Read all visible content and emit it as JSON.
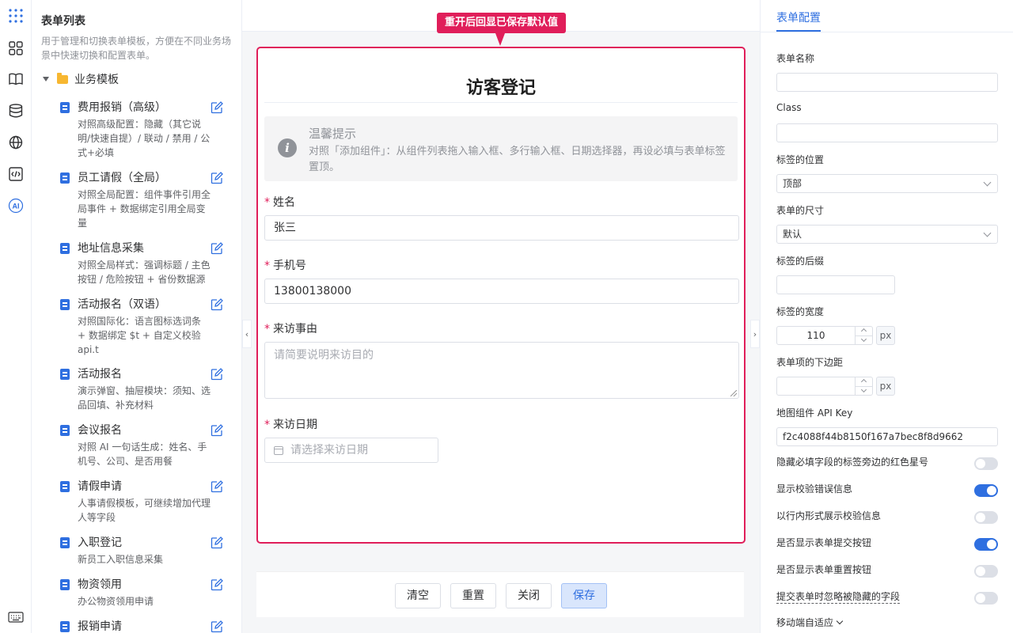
{
  "rail": {
    "icons": [
      "apps-grid-icon",
      "components-icon",
      "book-icon",
      "database-icon",
      "globe-icon",
      "code-icon",
      "ai-icon",
      "keyboard-icon"
    ],
    "ai_label": "AI",
    "accent": "#2f6fe0"
  },
  "list": {
    "title": "表单列表",
    "description": "用于管理和切换表单模板，方便在不同业务场景中快速切换和配置表单。",
    "group_label": "业务模板",
    "items": [
      {
        "name": "费用报销（高级）",
        "desc": "对照高级配置：隐藏（其它说明/快速自提）/ 联动 / 禁用 / 公式+必填"
      },
      {
        "name": "员工请假（全局）",
        "desc": "对照全局配置：组件事件引用全局事件 + 数据绑定引用全局变量"
      },
      {
        "name": "地址信息采集",
        "desc": "对照全局样式：强调标题 / 主色按钮 / 危险按钮 + 省份数据源"
      },
      {
        "name": "活动报名（双语）",
        "desc": "对照国际化：语言图标选词条 + 数据绑定 $t + 自定义校验 api.t"
      },
      {
        "name": "活动报名",
        "desc": "演示弹窗、抽屉模块：须知、选品回填、补充材料"
      },
      {
        "name": "会议报名",
        "desc": "对照 AI 一句话生成：姓名、手机号、公司、是否用餐"
      },
      {
        "name": "请假申请",
        "desc": "人事请假模板，可继续增加代理人等字段"
      },
      {
        "name": "入职登记",
        "desc": "新员工入职信息采集"
      },
      {
        "name": "物资领用",
        "desc": "办公物资领用申请"
      },
      {
        "name": "报销申请",
        "desc": ""
      }
    ]
  },
  "canvas": {
    "callout": "重开后回显已保存默认值",
    "accent": "#e01e5a",
    "form_title": "访客登记",
    "tip": {
      "title": "温馨提示",
      "text": "对照「添加组件」：从组件列表拖入输入框、多行输入框、日期选择器，再设必填与表单标签置顶。"
    },
    "fields": {
      "name": {
        "label": "姓名",
        "value": "张三"
      },
      "phone": {
        "label": "手机号",
        "value": "13800138000"
      },
      "reason": {
        "label": "来访事由",
        "placeholder": "请简要说明来访目的"
      },
      "date": {
        "label": "来访日期",
        "placeholder": "请选择来访日期"
      }
    },
    "required_mark": "*",
    "buttons": {
      "clear": "清空",
      "reset": "重置",
      "close": "关闭",
      "save": "保存"
    }
  },
  "config": {
    "tab": "表单配置",
    "form_name_label": "表单名称",
    "form_name_value": "",
    "class_label": "Class",
    "class_value": "",
    "label_position_label": "标签的位置",
    "label_position_value": "顶部",
    "form_size_label": "表单的尺寸",
    "form_size_value": "默认",
    "label_suffix_label": "标签的后缀",
    "label_suffix_value": "",
    "label_width_label": "标签的宽度",
    "label_width_value": "110",
    "label_width_unit": "px",
    "item_margin_label": "表单项的下边距",
    "item_margin_value": "",
    "item_margin_unit": "px",
    "map_key_label": "地图组件 API Key",
    "map_key_value": "f2c4088f44b8150f167a7bec8f8d9662",
    "switches": [
      {
        "label": "隐藏必填字段的标签旁边的红色星号",
        "on": false
      },
      {
        "label": "显示校验错误信息",
        "on": true
      },
      {
        "label": "以行内形式展示校验信息",
        "on": false
      },
      {
        "label": "是否显示表单提交按钮",
        "on": true
      },
      {
        "label": "是否显示表单重置按钮",
        "on": false
      },
      {
        "label": "提交表单时忽略被隐藏的字段",
        "on": false
      }
    ],
    "mobile_label": "移动端自适应"
  }
}
